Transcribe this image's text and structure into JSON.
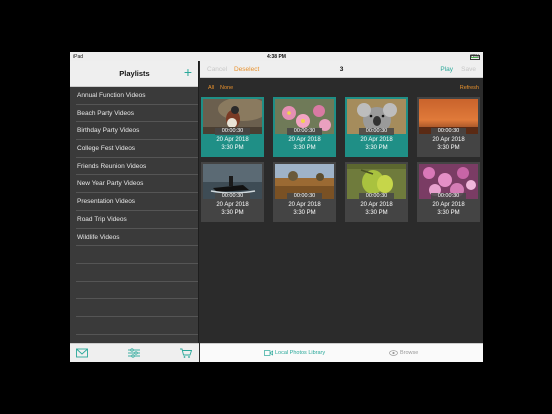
{
  "status_bar": {
    "device": "iPad",
    "time": "4:38 PM",
    "battery": "78%"
  },
  "sidebar": {
    "title": "Playlists",
    "add_label": "+",
    "playlists": [
      "Annual Function Videos",
      "Beach Party Videos",
      "Birthday Party Videos",
      "College Fest Videos",
      "Friends Reunion Videos",
      "New Year Party Videos",
      "Presentation Videos",
      "Road Trip Videos",
      "Wildlife Videos"
    ],
    "footer_icons": [
      "mail-icon",
      "settings-sliders-icon",
      "cart-icon"
    ]
  },
  "navbar": {
    "cancel": "Cancel",
    "deselect": "Deselect",
    "count": "3",
    "play": "Play",
    "save": "Save"
  },
  "filter": {
    "all": "All",
    "none": "None",
    "refresh": "Refresh"
  },
  "videos": [
    {
      "duration": "00:00:30",
      "date": "20 Apr 2018",
      "time": "3:30 PM",
      "selected": true,
      "thumb": "bird"
    },
    {
      "duration": "00:00:30",
      "date": "20 Apr 2018",
      "time": "3:30 PM",
      "selected": true,
      "thumb": "pink-flowers"
    },
    {
      "duration": "00:00:30",
      "date": "20 Apr 2018",
      "time": "3:30 PM",
      "selected": true,
      "thumb": "koala"
    },
    {
      "duration": "00:00:30",
      "date": "20 Apr 2018",
      "time": "3:30 PM",
      "selected": false,
      "thumb": "sunset"
    },
    {
      "duration": "00:00:30",
      "date": "20 Apr 2018",
      "time": "3:30 PM",
      "selected": false,
      "thumb": "jet-ski"
    },
    {
      "duration": "00:00:30",
      "date": "20 Apr 2018",
      "time": "3:30 PM",
      "selected": false,
      "thumb": "autumn-field"
    },
    {
      "duration": "00:00:30",
      "date": "20 Apr 2018",
      "time": "3:30 PM",
      "selected": false,
      "thumb": "green-fruit"
    },
    {
      "duration": "00:00:30",
      "date": "20 Apr 2018",
      "time": "3:30 PM",
      "selected": false,
      "thumb": "magenta-flowers"
    }
  ],
  "bottom_tabs": {
    "local": "Local Photos Library",
    "browse": "Browse"
  },
  "colors": {
    "accent": "#2aa89a",
    "orange": "#e8912d",
    "selected_card": "#1f8f86"
  }
}
